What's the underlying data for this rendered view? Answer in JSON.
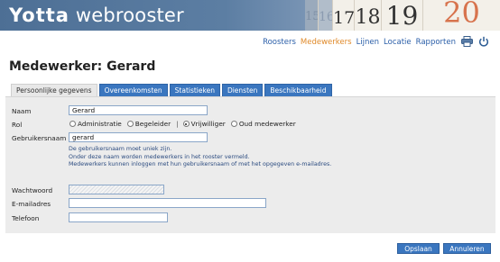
{
  "header": {
    "logo_bold": "Yotta",
    "logo_light": "webrooster",
    "calendar_days": [
      "15",
      "16",
      "17",
      "18",
      "19",
      "20"
    ]
  },
  "topnav": {
    "items": [
      "Roosters",
      "Medewerkers",
      "Lijnen",
      "Locatie",
      "Rapporten"
    ],
    "active_item": "Medewerkers",
    "icons": [
      "printer-icon",
      "power-icon"
    ]
  },
  "page": {
    "title": "Medewerker: Gerard"
  },
  "tabs": [
    {
      "label": "Persoonlijke gegevens",
      "active": true
    },
    {
      "label": "Overeenkomsten",
      "active": false
    },
    {
      "label": "Statistieken",
      "active": false
    },
    {
      "label": "Diensten",
      "active": false
    },
    {
      "label": "Beschikbaarheid",
      "active": false
    }
  ],
  "form": {
    "naam": {
      "label": "Naam",
      "value": "Gerard"
    },
    "rol": {
      "label": "Rol",
      "options": [
        "Administratie",
        "Begeleider",
        "Vrijwilliger",
        "Oud medewerker"
      ],
      "separator": "|",
      "selected": "Vrijwilliger"
    },
    "gebruikersnaam": {
      "label": "Gebruikersnaam",
      "value": "gerard"
    },
    "help_lines": [
      "De gebruikersnaam moet uniek zijn.",
      "Onder deze naam worden medewerkers in het rooster vermeld.",
      "Medewerkers kunnen inloggen met hun gebruikersnaam of met het opgegeven e-mailadres."
    ],
    "wachtwoord": {
      "label": "Wachtwoord",
      "value": ""
    },
    "emailadres": {
      "label": "E-mailadres",
      "value": ""
    },
    "telefoon": {
      "label": "Telefoon",
      "value": ""
    }
  },
  "buttons": {
    "save": "Opslaan",
    "cancel": "Annuleren"
  },
  "colors": {
    "accent": "#3a76bf",
    "active_nav": "#e08a2a",
    "link": "#2a5ea8"
  }
}
